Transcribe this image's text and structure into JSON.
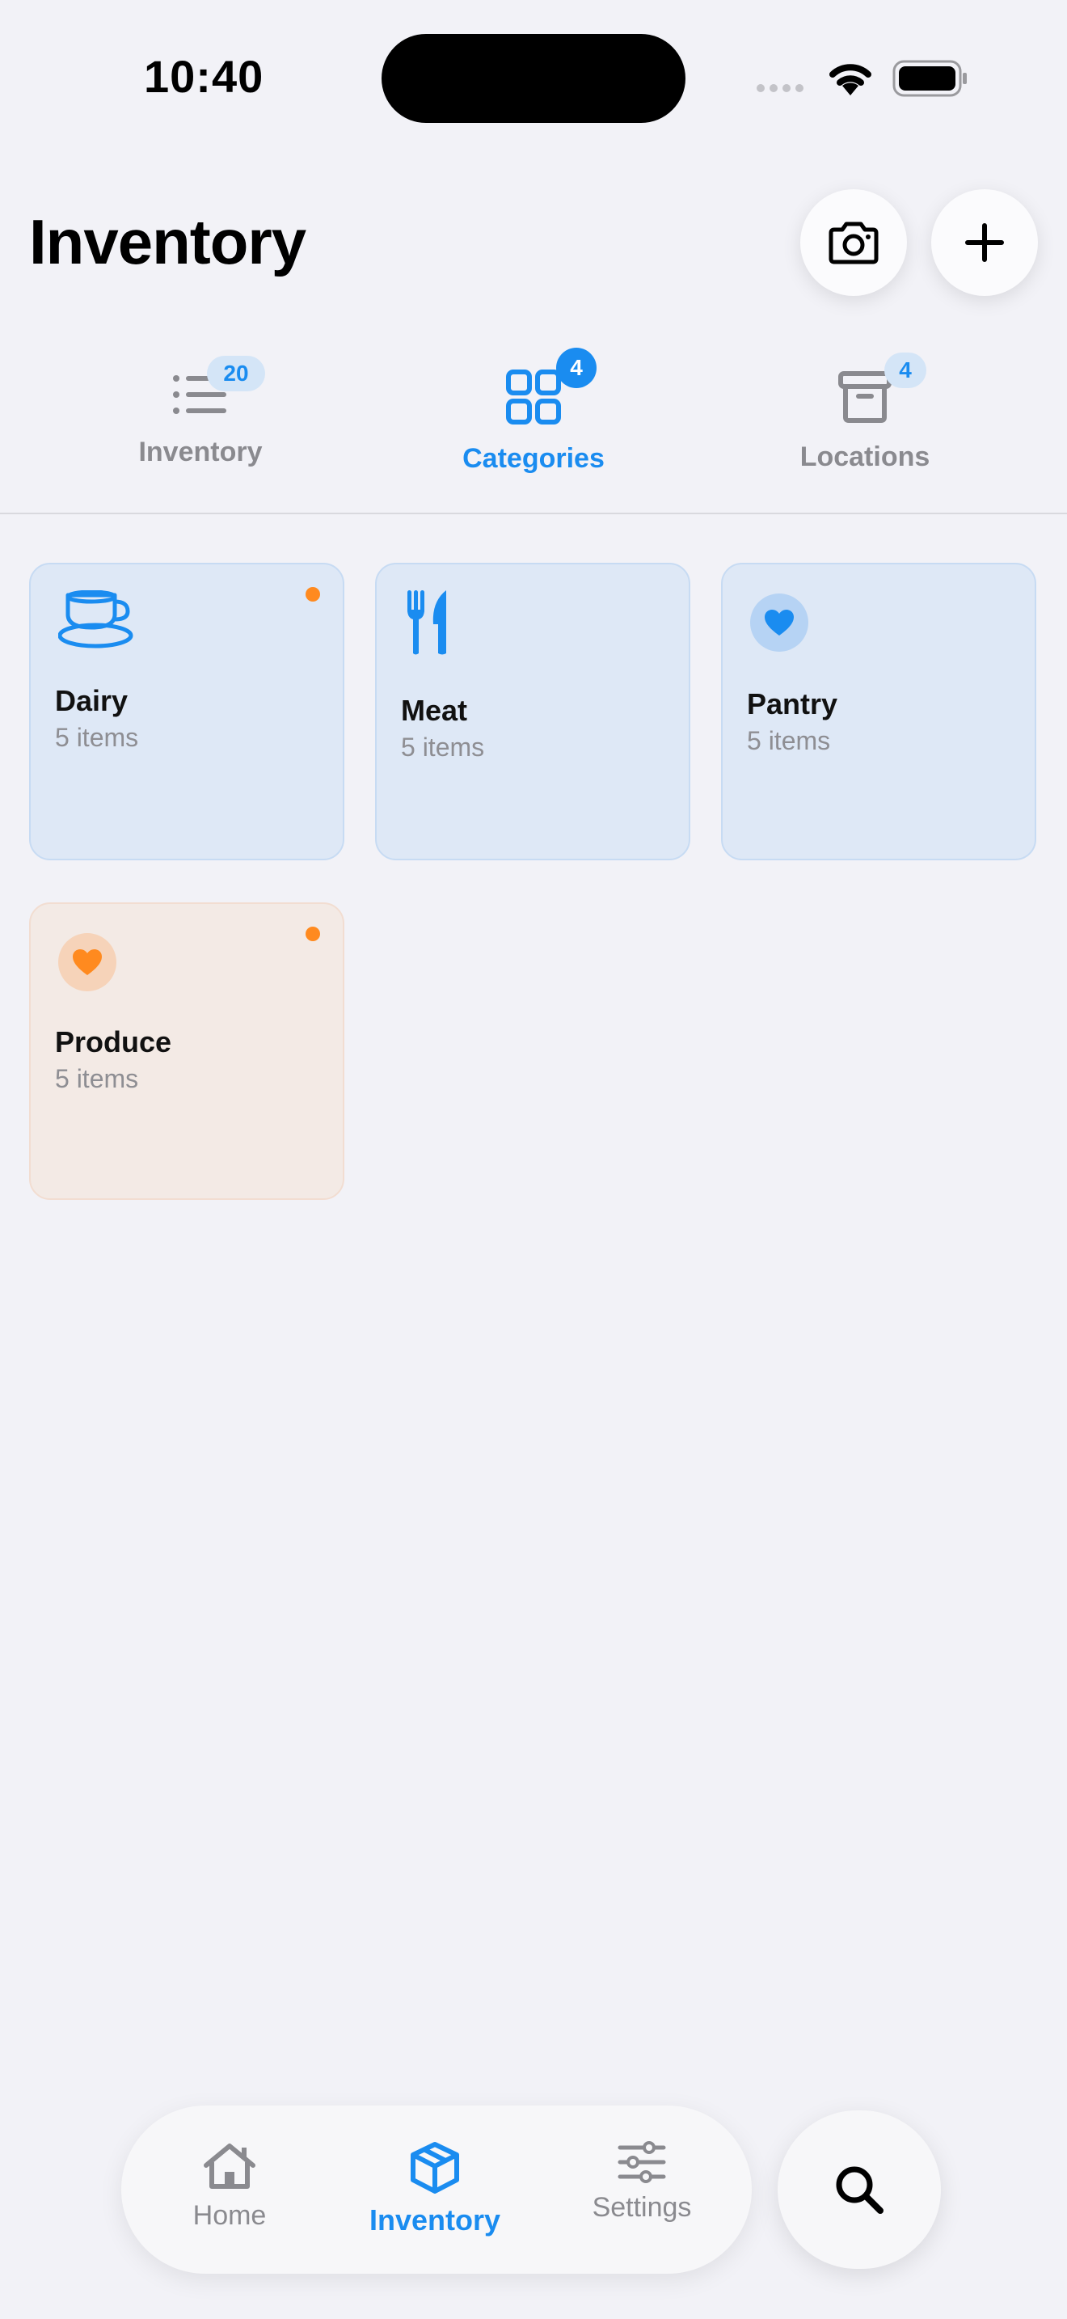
{
  "status_bar": {
    "time": "10:40"
  },
  "header": {
    "title": "Inventory",
    "camera_icon": "camera-icon",
    "add_icon": "plus-icon"
  },
  "segments": [
    {
      "label": "Inventory",
      "badge": "20",
      "icon": "list-icon",
      "active": false
    },
    {
      "label": "Categories",
      "badge": "4",
      "icon": "grid-icon",
      "active": true
    },
    {
      "label": "Locations",
      "badge": "4",
      "icon": "archive-box-icon",
      "active": false
    }
  ],
  "categories": [
    {
      "name": "Dairy",
      "count": "5 items",
      "icon": "cup-icon",
      "accent": "#1a8cf0",
      "has_dot": true
    },
    {
      "name": "Meat",
      "count": "5 items",
      "icon": "fork-knife-icon",
      "accent": "#1a8cf0",
      "has_dot": false
    },
    {
      "name": "Pantry",
      "count": "5 items",
      "icon": "heart-icon",
      "accent": "#1a8cf0",
      "has_dot": false
    },
    {
      "name": "Produce",
      "count": "5 items",
      "icon": "heart-icon",
      "accent": "#ff8a1f",
      "has_dot": true
    }
  ],
  "tabbar": {
    "tabs": [
      {
        "label": "Home",
        "icon": "house-icon",
        "active": false
      },
      {
        "label": "Inventory",
        "icon": "box-icon",
        "active": true
      },
      {
        "label": "Settings",
        "icon": "sliders-icon",
        "active": false
      }
    ],
    "search_icon": "magnifier-icon"
  },
  "colors": {
    "accent": "#1a8cf0",
    "warning_dot": "#ff8a1f",
    "background": "#f2f2f7"
  }
}
